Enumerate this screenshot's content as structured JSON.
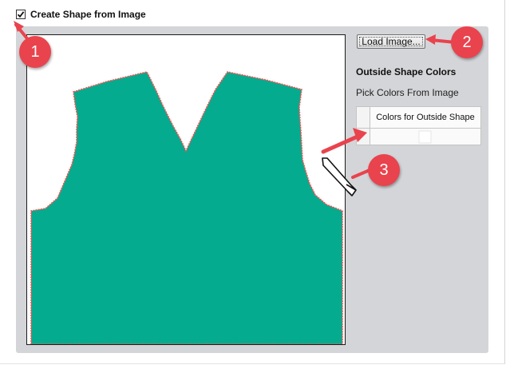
{
  "header": {
    "checkbox_label": "Create Shape from Image",
    "checked": true
  },
  "toolbar": {
    "load_label": "Load Image..."
  },
  "outside_colors": {
    "title": "Outside Shape Colors",
    "pick_label": "Pick Colors From Image",
    "table": {
      "column_header": "Colors for Outside Shape",
      "rows": [
        {
          "color": "#ffffff"
        }
      ]
    }
  },
  "callouts": [
    {
      "number": "1"
    },
    {
      "number": "2"
    },
    {
      "number": "3"
    }
  ],
  "colors": {
    "shape_fill": "#05ab8f",
    "shape_outline": "#ff4f4f",
    "callout": "#e9434d",
    "panel": "#d4d5d8"
  },
  "icons": {
    "eyedropper": "eyedropper-icon",
    "checkmark": "checkmark-icon"
  }
}
